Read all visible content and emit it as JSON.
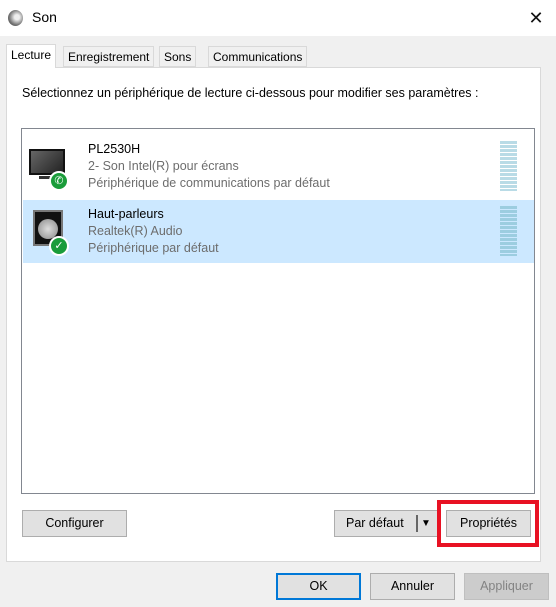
{
  "window": {
    "title": "Son",
    "close_icon": "close-icon"
  },
  "tabs": [
    {
      "label": "Lecture",
      "active": true
    },
    {
      "label": "Enregistrement"
    },
    {
      "label": "Sons"
    },
    {
      "label": "Communications"
    }
  ],
  "instruction": "Sélectionnez un périphérique de lecture ci-dessous pour modifier ses paramètres :",
  "devices": [
    {
      "name": "PL2530H",
      "driver": "2- Son Intel(R) pour écrans",
      "status": "Périphérique de communications par défaut",
      "icon": "monitor-icon",
      "badge": "phone-icon",
      "selected": false
    },
    {
      "name": "Haut-parleurs",
      "driver": "Realtek(R) Audio",
      "status": "Périphérique par défaut",
      "icon": "speaker-icon",
      "badge": "checkmark-icon",
      "selected": true
    }
  ],
  "buttons": {
    "configure": "Configurer",
    "set_default": "Par défaut",
    "properties": "Propriétés",
    "ok": "OK",
    "cancel": "Annuler",
    "apply": "Appliquer"
  },
  "colors": {
    "selection": "#cce8ff",
    "highlight": "#e81123",
    "accent": "#0078d7"
  }
}
